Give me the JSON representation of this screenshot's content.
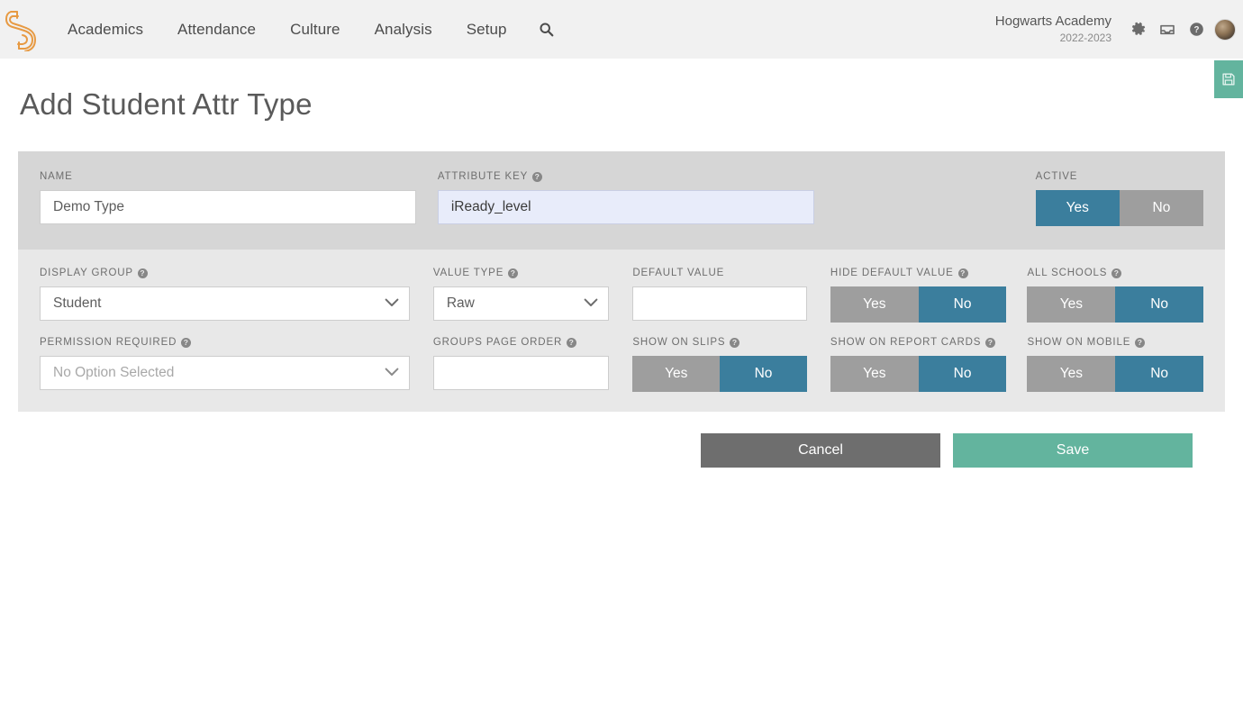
{
  "nav": {
    "logo_name": "kickboard-spiral-logo",
    "links": [
      {
        "label": "Academics"
      },
      {
        "label": "Attendance"
      },
      {
        "label": "Culture"
      },
      {
        "label": "Analysis"
      },
      {
        "label": "Setup"
      }
    ],
    "search_icon": "search-icon",
    "right": {
      "school_name": "Hogwarts Academy",
      "school_year": "2022-2023",
      "icons": [
        "gear-icon",
        "inbox-icon",
        "help-circle-icon"
      ],
      "avatar": "user-avatar"
    }
  },
  "side_tab": {
    "icon": "save-disk-icon",
    "color": "#63b49e"
  },
  "page": {
    "title": "Add Student Attr Type"
  },
  "form": {
    "name": {
      "label": "NAME",
      "value": "Demo Type",
      "placeholder": ""
    },
    "attribute_key": {
      "label": "ATTRIBUTE KEY",
      "help": "?",
      "value": "iReady_level",
      "placeholder": ""
    },
    "active": {
      "label": "ACTIVE",
      "yes": "Yes",
      "no": "No",
      "selected": "Yes"
    },
    "display_group": {
      "label": "DISPLAY GROUP",
      "help": "?",
      "value": "Student"
    },
    "value_type": {
      "label": "VALUE TYPE",
      "help": "?",
      "value": "Raw"
    },
    "default_value": {
      "label": "DEFAULT VALUE",
      "value": "",
      "placeholder": ""
    },
    "hide_default_value": {
      "label": "HIDE DEFAULT VALUE",
      "help": "?",
      "yes": "Yes",
      "no": "No",
      "selected": "No"
    },
    "all_schools": {
      "label": "ALL SCHOOLS",
      "help": "?",
      "yes": "Yes",
      "no": "No",
      "selected": "No"
    },
    "permission_required": {
      "label": "PERMISSION REQUIRED",
      "help": "?",
      "value": "No Option Selected"
    },
    "groups_page_order": {
      "label": "GROUPS PAGE ORDER",
      "help": "?",
      "value": "",
      "placeholder": ""
    },
    "show_on_slips": {
      "label": "SHOW ON SLIPS",
      "help": "?",
      "yes": "Yes",
      "no": "No",
      "selected": "No"
    },
    "show_on_report_cards": {
      "label": "SHOW ON REPORT CARDS",
      "help": "?",
      "yes": "Yes",
      "no": "No",
      "selected": "No"
    },
    "show_on_mobile": {
      "label": "SHOW ON MOBILE",
      "help": "?",
      "yes": "Yes",
      "no": "No",
      "selected": "No"
    }
  },
  "actions": {
    "cancel": "Cancel",
    "save": "Save"
  },
  "colors": {
    "accent_orange": "#e79a43",
    "toggle_on": "#3b7e9d",
    "toggle_off": "#9e9e9e",
    "save_green": "#63b49e",
    "panel_top": "#d6d6d6",
    "panel_bottom": "#e8e8e8"
  }
}
